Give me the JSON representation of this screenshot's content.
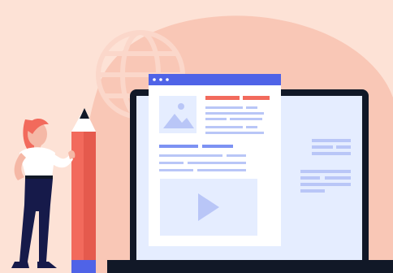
{
  "scene": {
    "description_icons": [
      "globe-icon",
      "image-placeholder-icon",
      "play-video-icon"
    ],
    "colors": {
      "background": "#fde2d6",
      "blob": "#f9c7b6",
      "globe_stroke": "#fbd7ca",
      "laptop_frame": "#111827",
      "laptop_screen": "#e5edff",
      "browser_bar": "#4f63e7",
      "browser_page": "#ffffff",
      "accent_red": "#f26a5c",
      "accent_blue": "#7d92f3",
      "muted_blue": "#b9c6f7",
      "pencil_body": "#f26a5c",
      "pencil_band": "#4f63e7",
      "pencil_tip": "#111827",
      "hair": "#f26a5c",
      "skin": "#f5b8a6",
      "shirt": "#ffffff",
      "pants": "#161a4a"
    }
  }
}
